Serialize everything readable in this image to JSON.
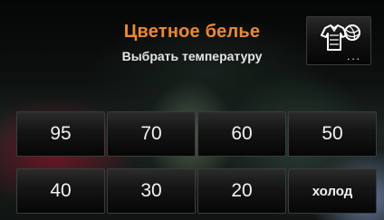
{
  "header": {
    "title": "Цветное белье",
    "subtitle": "Выбрать температуру"
  },
  "program_button": {
    "icon": "garments-and-yarn-icon",
    "dots": "..."
  },
  "temperatures": {
    "row1": [
      "95",
      "70",
      "60",
      "50"
    ],
    "row2": [
      "40",
      "30",
      "20",
      "холод"
    ]
  },
  "colors": {
    "title": "#f0882a",
    "text": "#e6e6e6"
  }
}
